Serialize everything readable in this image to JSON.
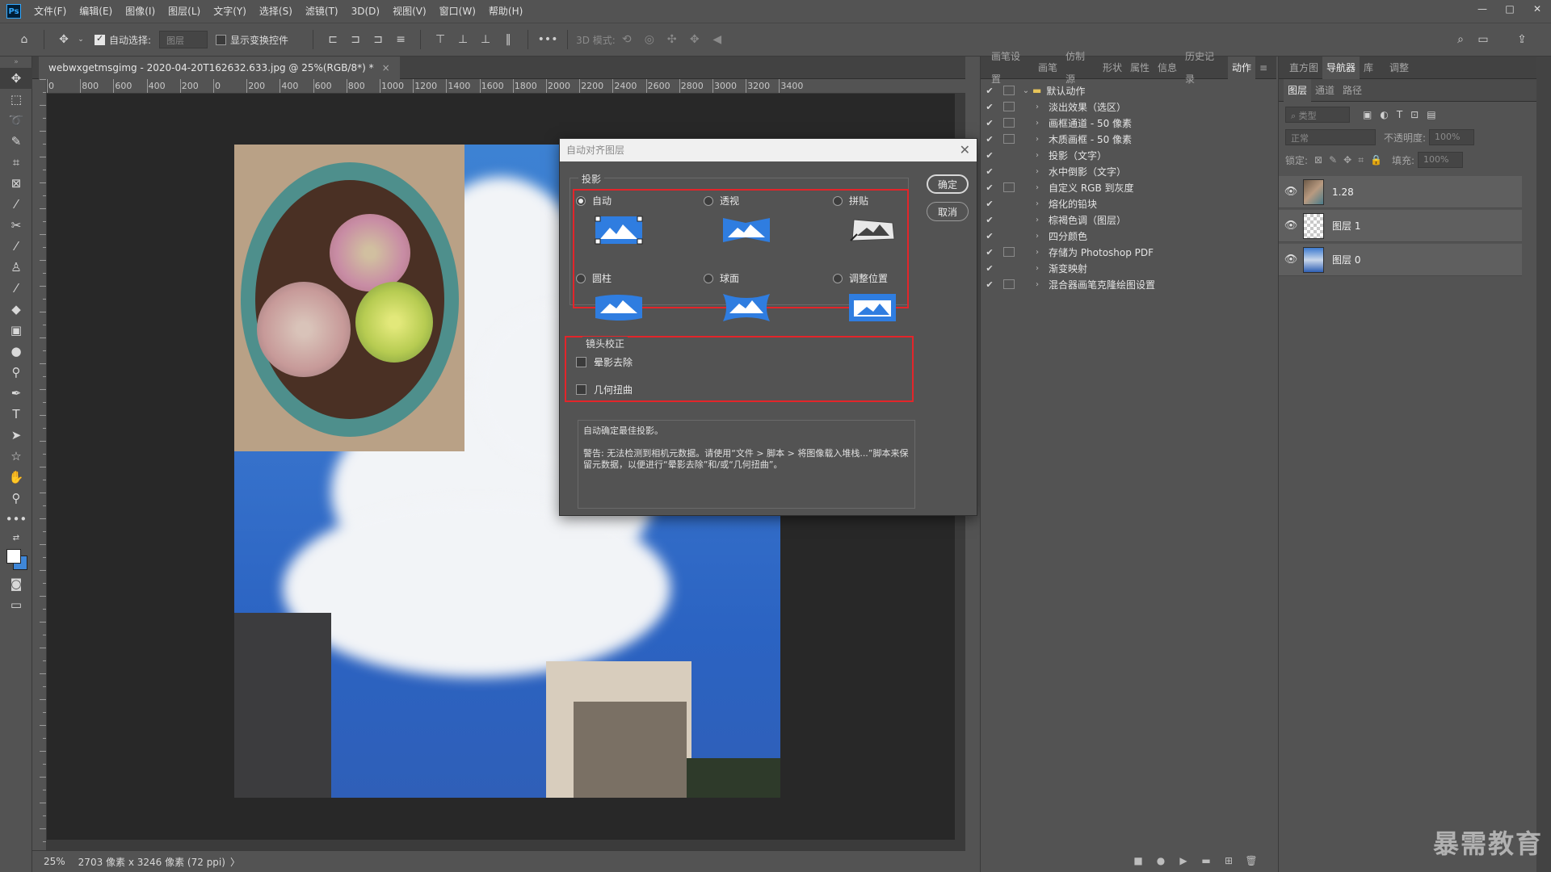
{
  "app": {
    "logo": "Ps",
    "menu": [
      "文件(F)",
      "编辑(E)",
      "图像(I)",
      "图层(L)",
      "文字(Y)",
      "选择(S)",
      "滤镜(T)",
      "3D(D)",
      "视图(V)",
      "窗口(W)",
      "帮助(H)"
    ],
    "window_controls": [
      "—",
      "□",
      "✕"
    ]
  },
  "options_bar": {
    "auto_select_label": "自动选择:",
    "auto_select_value": "图层",
    "show_transform_label": "显示变换控件",
    "mode_3d_label": "3D 模式:",
    "more": "•••"
  },
  "document": {
    "tab_title": "webwxgetmsgimg - 2020-04-20T162632.633.jpg @ 25%(RGB/8*) *",
    "tab_close": "×",
    "ruler_labels": [
      "0",
      "800",
      "600",
      "400",
      "200",
      "0",
      "200",
      "400",
      "600",
      "800",
      "1000",
      "1200",
      "1400",
      "1600",
      "1800",
      "2000",
      "2200",
      "2400",
      "2600",
      "2800",
      "3000",
      "3200",
      "3400"
    ],
    "status_zoom": "25%",
    "status_info": "2703 像素 x 3246 像素 (72 ppi)",
    "status_arrow": "〉"
  },
  "dialog": {
    "title": "自动对齐图层",
    "close": "✕",
    "projection_label": "投影",
    "options": [
      {
        "label": "自动",
        "checked": true
      },
      {
        "label": "透视",
        "checked": false
      },
      {
        "label": "拼贴",
        "checked": false
      },
      {
        "label": "圆柱",
        "checked": false
      },
      {
        "label": "球面",
        "checked": false
      },
      {
        "label": "调整位置",
        "checked": false
      }
    ],
    "ok": "确定",
    "cancel": "取消",
    "lens_label": "镜头校正",
    "vignette": "晕影去除",
    "distortion": "几何扭曲",
    "desc_line1": "自动确定最佳投影。",
    "desc_line2": "警告: 无法检测到相机元数据。请使用“文件 > 脚本 > 将图像载入堆栈...”脚本来保留元数据，以便进行“晕影去除”和/或“几何扭曲”。"
  },
  "actions_panel": {
    "tabs": [
      "画笔设置",
      "画笔",
      "仿制源",
      "形状",
      "属性",
      "信息",
      "历史记录",
      "动作"
    ],
    "active_tab": "动作",
    "set_name": "默认动作",
    "items": [
      {
        "name": "淡出效果（选区）",
        "dialog": true
      },
      {
        "name": "画框通道 - 50 像素",
        "dialog": true
      },
      {
        "name": "木质画框 - 50 像素",
        "dialog": true
      },
      {
        "name": "投影（文字）",
        "dialog": false
      },
      {
        "name": "水中倒影（文字）",
        "dialog": false
      },
      {
        "name": "自定义 RGB 到灰度",
        "dialog": true
      },
      {
        "name": "熔化的铅块",
        "dialog": false
      },
      {
        "name": "棕褐色调（图层）",
        "dialog": false
      },
      {
        "name": "四分颜色",
        "dialog": false
      },
      {
        "name": "存储为 Photoshop PDF",
        "dialog": true
      },
      {
        "name": "渐变映射",
        "dialog": false
      },
      {
        "name": "混合器画笔克隆绘图设置",
        "dialog": true
      }
    ]
  },
  "right_panel": {
    "top_tabs": [
      "直方图",
      "导航器",
      "库",
      "调整"
    ],
    "active_top_tab": "导航器",
    "layer_tabs": [
      "图层",
      "通道",
      "路径"
    ],
    "active_layer_tab": "图层",
    "filter_placeholder": "类型",
    "blend_mode": "正常",
    "opacity_label": "不透明度:",
    "opacity_value": "100%",
    "lock_label": "锁定:",
    "fill_label": "填充:",
    "fill_value": "100%",
    "layers": [
      {
        "name": "1.28"
      },
      {
        "name": "图层 1"
      },
      {
        "name": "图层 0"
      }
    ]
  },
  "watermark": "暴需教育",
  "colors": {
    "highlight_red": "#e3252a",
    "icon_blue": "#2f7de0"
  }
}
